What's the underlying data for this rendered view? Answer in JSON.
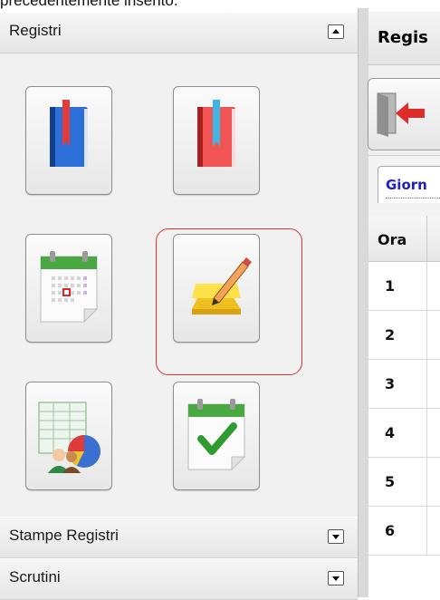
{
  "caption": "precedentemente inserito.",
  "sidebar": {
    "sections": [
      {
        "label": "Registri",
        "toggle": "collapse"
      },
      {
        "label": "Stampe Registri",
        "toggle": "expand"
      },
      {
        "label": "Scrutini",
        "toggle": "expand"
      }
    ],
    "icons": [
      {
        "name": "registro-classe-icon"
      },
      {
        "name": "registro-professore-icon"
      },
      {
        "name": "calendario-icon"
      },
      {
        "name": "note-pencil-icon"
      },
      {
        "name": "statistiche-icon"
      },
      {
        "name": "calendario-check-icon"
      }
    ],
    "selected_icon": "note-pencil-icon"
  },
  "main": {
    "title": "Regis",
    "tab_label": "Giorn",
    "table": {
      "header": "Ora",
      "rows": [
        "1",
        "2",
        "3",
        "4",
        "5",
        "6"
      ]
    }
  },
  "colors": {
    "selection": "#e03030",
    "tab_text": "#1d1dcc"
  }
}
